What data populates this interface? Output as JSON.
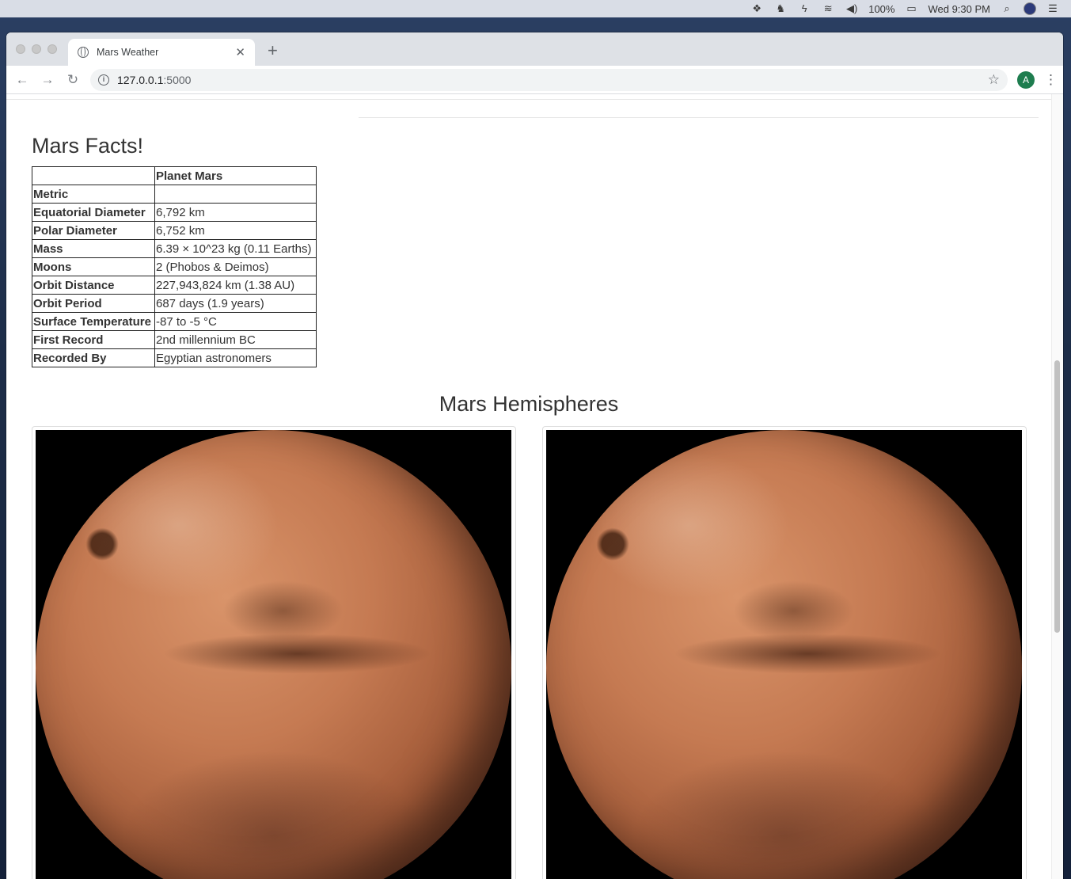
{
  "menubar": {
    "battery": "100%",
    "clock": "Wed 9:30 PM"
  },
  "browser": {
    "tab_title": "Mars Weather",
    "url_host": "127.0.0.1",
    "url_port": ":5000",
    "account_initial": "A"
  },
  "facts": {
    "title": "Mars Facts!",
    "column_header": "Planet Mars",
    "rows": [
      {
        "label": "Metric",
        "value": ""
      },
      {
        "label": "Equatorial Diameter",
        "value": "6,792 km"
      },
      {
        "label": "Polar Diameter",
        "value": "6,752 km"
      },
      {
        "label": "Mass",
        "value": "6.39 × 10^23 kg (0.11 Earths)"
      },
      {
        "label": "Moons",
        "value": "2 (Phobos & Deimos)"
      },
      {
        "label": "Orbit Distance",
        "value": "227,943,824 km (1.38 AU)"
      },
      {
        "label": "Orbit Period",
        "value": "687 days (1.9 years)"
      },
      {
        "label": "Surface Temperature",
        "value": "-87 to -5 °C"
      },
      {
        "label": "First Record",
        "value": "2nd millennium BC"
      },
      {
        "label": "Recorded By",
        "value": "Egyptian astronomers"
      }
    ]
  },
  "hemispheres": {
    "title": "Mars Hemispheres"
  },
  "colors": {
    "tabstrip": "#dee1e6",
    "account_avatar": "#1e7d4f",
    "text": "#333333"
  }
}
